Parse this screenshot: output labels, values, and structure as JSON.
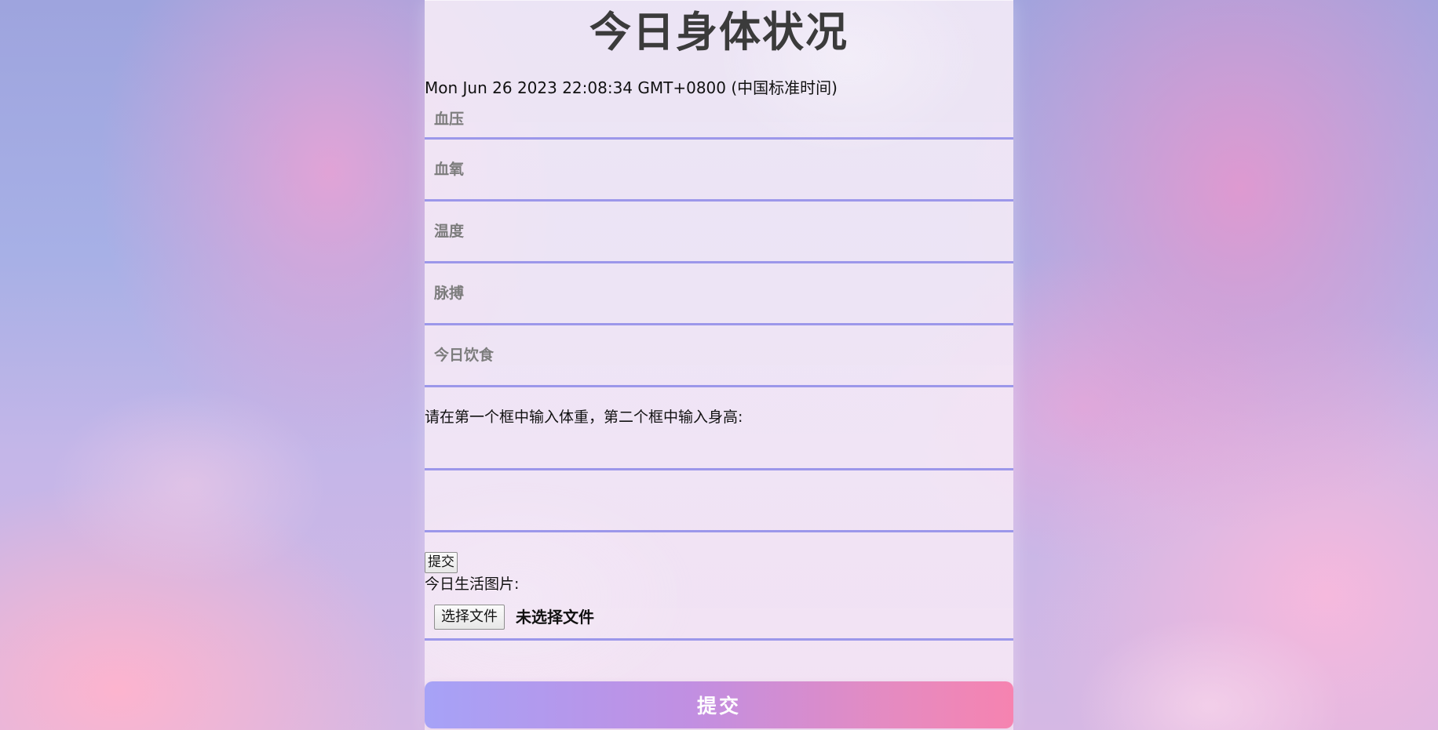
{
  "page": {
    "title": "今日身体状况",
    "date": "Mon Jun 26 2023 22:08:34 GMT+0800 (中国标准时间)"
  },
  "form": {
    "fields": [
      {
        "placeholder": "血压",
        "value": ""
      },
      {
        "placeholder": "血氧",
        "value": ""
      },
      {
        "placeholder": "温度",
        "value": ""
      },
      {
        "placeholder": "脉搏",
        "value": ""
      },
      {
        "placeholder": "今日饮食",
        "value": ""
      }
    ],
    "instruction": "请在第一个框中输入体重，第二个框中输入身高:",
    "weight": {
      "placeholder": "",
      "value": ""
    },
    "height": {
      "placeholder": "",
      "value": ""
    },
    "small_submit_label": "提交",
    "photo_label": "今日生活图片:",
    "file_button_label": "选择文件",
    "file_status": "未选择文件",
    "submit_label": "提交"
  }
}
